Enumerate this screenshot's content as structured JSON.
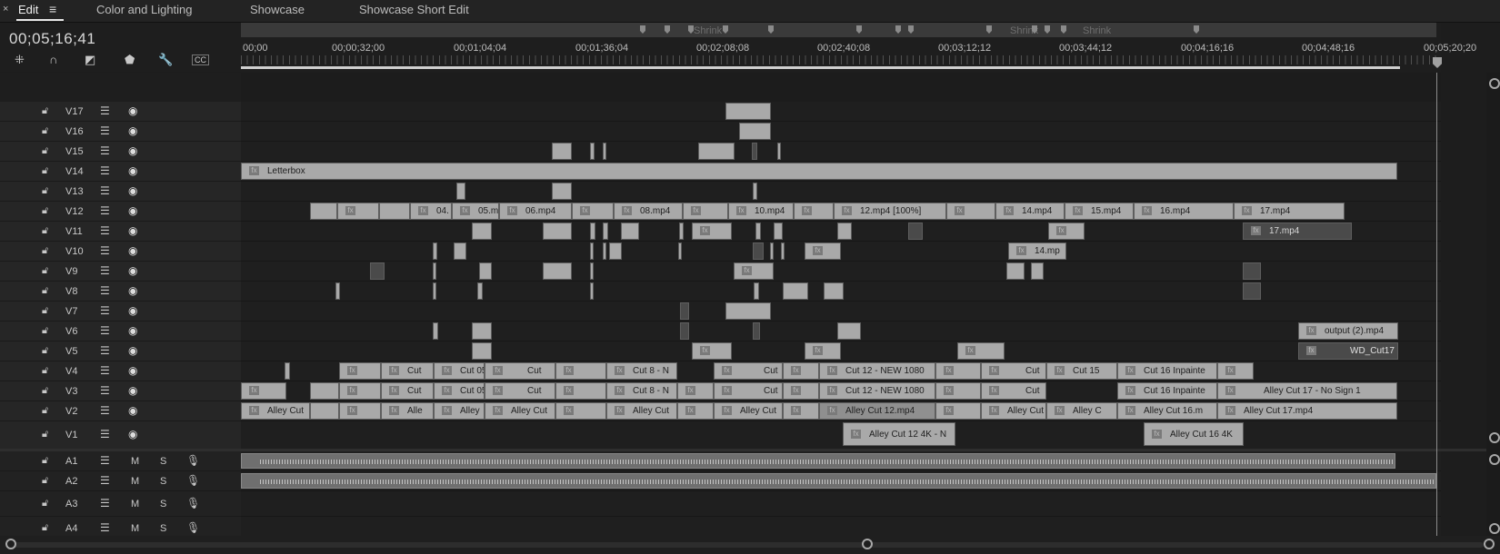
{
  "tabs": [
    {
      "label": "Edit",
      "active": true
    },
    {
      "label": "Color and Lighting"
    },
    {
      "label": "Showcase"
    },
    {
      "label": "Showcase Short Edit"
    }
  ],
  "timecode": "00;05;16;41",
  "ruler": {
    "ticks": [
      "00;00",
      "00;00;32;00",
      "00;01;04;04",
      "00;01;36;04",
      "00;02;08;08",
      "00;02;40;08",
      "00;03;12;12",
      "00;03;44;12",
      "00;04;16;16",
      "00;04;48;16",
      "00;05;20;20"
    ],
    "marker_labels": [
      "Shrink",
      "Shrink",
      "Shrink"
    ]
  },
  "video_tracks": [
    "V17",
    "V16",
    "V15",
    "V14",
    "V13",
    "V12",
    "V11",
    "V10",
    "V9",
    "V8",
    "V7",
    "V6",
    "V5",
    "V4",
    "V3",
    "V2",
    "V1"
  ],
  "audio_tracks": [
    "A1",
    "A2",
    "A3",
    "A4"
  ],
  "audio_buttons": {
    "mute": "M",
    "solo": "S"
  },
  "clips": {
    "v14": [
      "Letterbox"
    ],
    "v12": [
      "04.",
      "05.mp",
      "06.mp4",
      "08.mp4",
      "10.mp4",
      "12.mp4 [100%]",
      "14.mp4",
      "15.mp4",
      "16.mp4",
      "17.mp4"
    ],
    "v11": [
      "17.mp4"
    ],
    "v10": [
      "14.mp"
    ],
    "v6": [
      "output (2).mp4"
    ],
    "v5": [
      "WD_Cut17"
    ],
    "v4": [
      "Cut",
      "Cut 05",
      "Cut",
      "Cut 8 - N",
      "Cut",
      "Cut 12 - NEW 1080",
      "Cut",
      "Cut 15",
      "Cut 16 Inpainte"
    ],
    "v3": [
      "Cut",
      "Cut 05",
      "Cut",
      "Cut 8 - N",
      "Cut",
      "Cut 12 - NEW 1080",
      "Cut",
      "Cut 16 Inpainte",
      "Alley Cut 17 - No Sign 1"
    ],
    "v2": [
      "Alley Cut",
      "Alle",
      "Alley",
      "Alley Cut",
      "Alley Cut",
      "Alley Cut",
      "Alley Cut 12.mp4",
      "Alley Cut",
      "Alley C",
      "Alley Cut 16.m",
      "Alley Cut 17.mp4"
    ],
    "v1": [
      "Alley Cut 12 4K - N",
      "Alley Cut 16 4K"
    ]
  }
}
